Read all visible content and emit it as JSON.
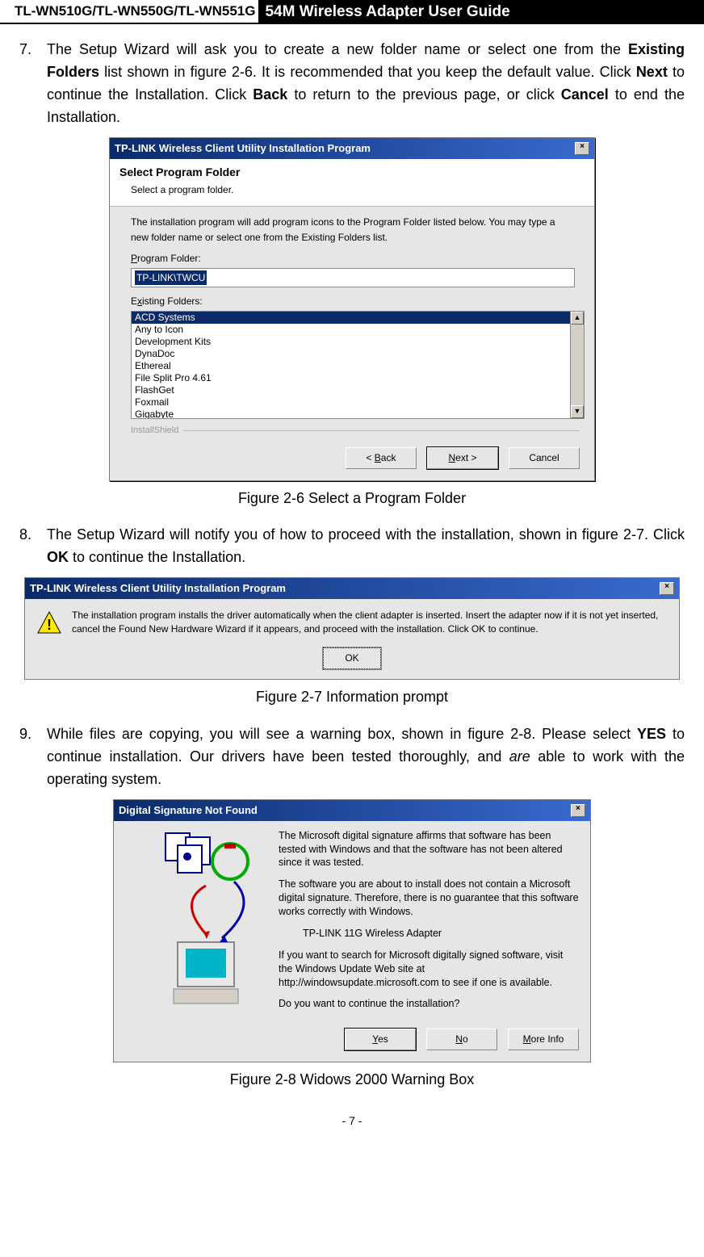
{
  "header": {
    "left": "TL-WN510G/TL-WN550G/TL-WN551G",
    "right": "54M Wireless Adapter User Guide"
  },
  "step7": {
    "num": "7.",
    "text_before": "The Setup Wizard will ask you to create a new folder name or select one from the ",
    "bold1": "Existing Folders",
    "text_mid1": " list shown in figure 2-6. It is recommended that you keep the default value. Click ",
    "bold2": "Next",
    "text_mid2": " to continue the Installation. Click ",
    "bold3": "Back",
    "text_mid3": " to return to the previous page, or click ",
    "bold4": "Cancel",
    "text_end": " to end the Installation."
  },
  "fig26": {
    "title": "TP-LINK Wireless Client Utility Installation Program",
    "heading": "Select Program Folder",
    "sub": "Select a program folder.",
    "desc": "The installation program will add program icons to the Program Folder listed below. You may type a new folder name or select one from the Existing Folders list.",
    "lbl_pf": "Program Folder:",
    "pf_val": "TP-LINK\\TWCU",
    "lbl_ef": "Existing Folders:",
    "folders": [
      "ACD Systems",
      "Any to Icon",
      "Development Kits",
      "DynaDoc",
      "Ethereal",
      "File Split Pro 4.61",
      "FlashGet",
      "Foxmail",
      "Gigabyte"
    ],
    "ishield": "InstallShield",
    "btn_back": "< Back",
    "btn_next": "Next >",
    "btn_cancel": "Cancel"
  },
  "cap26": "Figure 2-6    Select a Program Folder",
  "step8": {
    "num": "8.",
    "text_before": "The Setup Wizard will notify you of how to proceed with the installation, shown in figure 2-7. Click ",
    "bold1": "OK",
    "text_end": " to continue the Installation."
  },
  "fig27": {
    "title": "TP-LINK Wireless Client Utility Installation Program",
    "msg": "The installation program installs the driver automatically when the client adapter is inserted. Insert the adapter now if it is not yet inserted, cancel the Found New Hardware Wizard if it appears, and proceed with the installation. Click OK to continue.",
    "btn_ok": "OK"
  },
  "cap27": "Figure 2-7    Information prompt",
  "step9": {
    "num": "9.",
    "text_before": "While files are copying, you will see a warning box, shown in figure 2-8. Please select ",
    "bold1": "YES",
    "text_mid": " to continue installation. Our drivers have been tested thoroughly, and ",
    "ital": "are",
    "text_end": " able to work with the operating system."
  },
  "fig28": {
    "title": "Digital Signature Not Found",
    "p1": "The Microsoft digital signature affirms that software has been tested with Windows and that the software has not been altered since it was tested.",
    "p2": "The software you are about to install does not contain a Microsoft digital signature. Therefore, there is no guarantee that this software works correctly with Windows.",
    "device": "TP-LINK 11G Wireless Adapter",
    "p3": "If you want to search for Microsoft digitally signed software, visit the Windows Update Web site at http://windowsupdate.microsoft.com to see if one is available.",
    "q": "Do you want to continue the installation?",
    "btn_yes": "Yes",
    "btn_no": "No",
    "btn_more": "More Info"
  },
  "cap28": "Figure 2-8    Widows 2000 Warning Box",
  "pgno": "- 7 -"
}
